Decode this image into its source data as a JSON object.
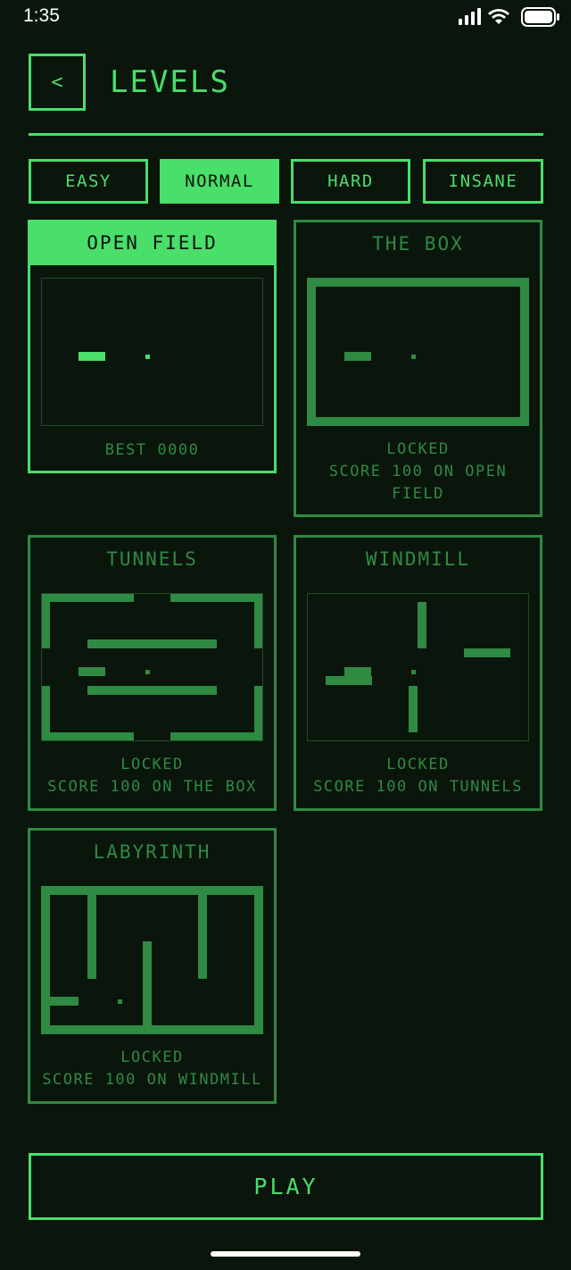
{
  "status_bar": {
    "time": "1:35"
  },
  "header": {
    "back_label": "<",
    "title": "LEVELS"
  },
  "tabs": [
    {
      "label": "EASY",
      "active": false
    },
    {
      "label": "NORMAL",
      "active": true
    },
    {
      "label": "HARD",
      "active": false
    },
    {
      "label": "INSANE",
      "active": false
    }
  ],
  "levels": [
    {
      "title": "OPEN FIELD",
      "status": "BEST 0000",
      "hint": ""
    },
    {
      "title": "THE BOX",
      "status": "LOCKED",
      "hint": "SCORE 100 ON OPEN FIELD"
    },
    {
      "title": "TUNNELS",
      "status": "LOCKED",
      "hint": "SCORE 100 ON THE BOX"
    },
    {
      "title": "WINDMILL",
      "status": "LOCKED",
      "hint": "SCORE 100 ON TUNNELS"
    },
    {
      "title": "LABYRINTH",
      "status": "LOCKED",
      "hint": "SCORE 100 ON WINDMILL"
    }
  ],
  "play_label": "PLAY",
  "colors": {
    "accent": "#4ade6a",
    "dim": "#2f8a42",
    "background": "#0a150c"
  }
}
